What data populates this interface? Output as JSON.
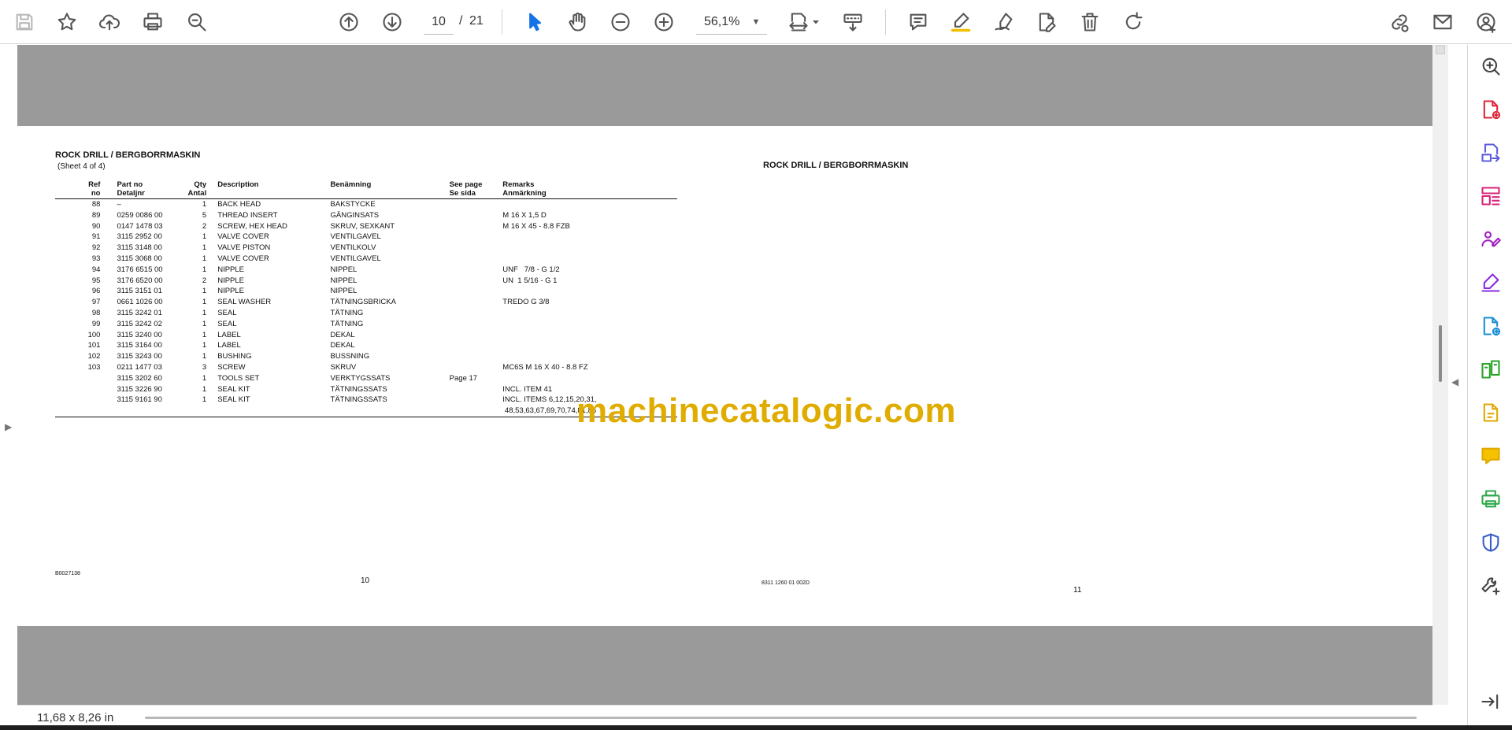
{
  "toolbar": {
    "page_current": "10",
    "page_separator": "/",
    "page_total": "21",
    "zoom": "56,1%"
  },
  "icons": {
    "save": "save-icon",
    "bookmark": "star-icon",
    "upload": "cloud-upload-icon",
    "print": "print-icon",
    "find": "search-icon",
    "prev_page": "arrow-up-circle-icon",
    "next_page": "arrow-down-circle-icon",
    "zoom_out": "zoom-out-icon",
    "zoom_in": "zoom-in-icon",
    "select": "cursor-icon",
    "hand": "hand-icon",
    "fit": "fit-page-icon",
    "scroll": "scroll-mode-icon",
    "comment": "comment-icon",
    "highlight": "highlight-icon",
    "sign": "sign-icon",
    "edit_pdf": "edit-pdf-icon",
    "delete": "trash-icon",
    "rotate": "rotate-icon",
    "share_link": "share-link-icon",
    "email": "mail-icon",
    "account": "account-icon"
  },
  "left_page": {
    "title": "ROCK DRILL / BERGBORRMASKIN",
    "subtitle": "(Sheet 4 of 4)",
    "headers": {
      "ref1": "Ref",
      "ref2": "no",
      "part1": "Part no",
      "part2": "Detaljnr",
      "qty1": "Qty",
      "qty2": "Antal",
      "desc": "Description",
      "ben": "Benämning",
      "see1": "See page",
      "see2": "Se sida",
      "rem1": "Remarks",
      "rem2": "Anmärkning"
    },
    "rows": [
      {
        "ref": "88",
        "part": "–",
        "qty": "1",
        "desc": "BACK HEAD",
        "ben": "BAKSTYCKE",
        "see": "",
        "rem": ""
      },
      {
        "ref": "89",
        "part": "0259 0086 00",
        "qty": "5",
        "desc": "THREAD INSERT",
        "ben": "GÄNGINSATS",
        "see": "",
        "rem": "M 16 X 1,5 D"
      },
      {
        "ref": "90",
        "part": "0147 1478 03",
        "qty": "2",
        "desc": "SCREW, HEX HEAD",
        "ben": "SKRUV, SEXKANT",
        "see": "",
        "rem": "M 16 X 45 - 8.8 FZB"
      },
      {
        "ref": "91",
        "part": "3115 2952 00",
        "qty": "1",
        "desc": "VALVE COVER",
        "ben": "VENTILGAVEL",
        "see": "",
        "rem": ""
      },
      {
        "ref": "92",
        "part": "3115 3148 00",
        "qty": "1",
        "desc": "VALVE PISTON",
        "ben": "VENTILKOLV",
        "see": "",
        "rem": ""
      },
      {
        "ref": "93",
        "part": "3115 3068 00",
        "qty": "1",
        "desc": "VALVE COVER",
        "ben": "VENTILGAVEL",
        "see": "",
        "rem": ""
      },
      {
        "ref": "94",
        "part": "3176 6515 00",
        "qty": "1",
        "desc": "NIPPLE",
        "ben": "NIPPEL",
        "see": "",
        "rem": "UNF   7/8 - G 1/2"
      },
      {
        "ref": "95",
        "part": "3176 6520 00",
        "qty": "2",
        "desc": "NIPPLE",
        "ben": "NIPPEL",
        "see": "",
        "rem": "UN  1 5/16 - G 1"
      },
      {
        "ref": "96",
        "part": "3115 3151 01",
        "qty": "1",
        "desc": "NIPPLE",
        "ben": "NIPPEL",
        "see": "",
        "rem": ""
      },
      {
        "ref": "97",
        "part": "0661 1026 00",
        "qty": "1",
        "desc": "SEAL WASHER",
        "ben": "TÄTNINGSBRICKA",
        "see": "",
        "rem": "TREDO G 3/8"
      },
      {
        "ref": "98",
        "part": "3115 3242 01",
        "qty": "1",
        "desc": "SEAL",
        "ben": "TÄTNING",
        "see": "",
        "rem": ""
      },
      {
        "ref": "99",
        "part": "3115 3242 02",
        "qty": "1",
        "desc": "SEAL",
        "ben": "TÄTNING",
        "see": "",
        "rem": ""
      },
      {
        "ref": "100",
        "part": "3115 3240 00",
        "qty": "1",
        "desc": "LABEL",
        "ben": "DEKAL",
        "see": "",
        "rem": ""
      },
      {
        "ref": "101",
        "part": "3115 3164 00",
        "qty": "1",
        "desc": "LABEL",
        "ben": "DEKAL",
        "see": "",
        "rem": ""
      },
      {
        "ref": "102",
        "part": "3115 3243 00",
        "qty": "1",
        "desc": "BUSHING",
        "ben": "BUSSNING",
        "see": "",
        "rem": ""
      },
      {
        "ref": "103",
        "part": "0211 1477 03",
        "qty": "3",
        "desc": "SCREW",
        "ben": "SKRUV",
        "see": "",
        "rem": "MC6S M 16 X 40 - 8.8 FZ"
      },
      {
        "ref": "",
        "part": "3115 3202 60",
        "qty": "1",
        "desc": "TOOLS SET",
        "ben": "VERKTYGSSATS",
        "see": "Page 17",
        "rem": ""
      },
      {
        "ref": "",
        "part": "3115 3226 90",
        "qty": "1",
        "desc": "SEAL KIT",
        "ben": "TÄTNINGSSATS",
        "see": "",
        "rem": "INCL. ITEM 41"
      },
      {
        "ref": "",
        "part": "3115 9161 90",
        "qty": "1",
        "desc": "SEAL KIT",
        "ben": "TÄTNINGSSATS",
        "see": "",
        "rem": "INCL. ITEMS 6,12,15,20,31,\n 48,53,63,67,69,70,74,81,86"
      }
    ],
    "doc_code": "B0027138",
    "page_number": "10"
  },
  "right_page": {
    "title": "ROCK DRILL / BERGBORRMASKIN",
    "doc_code": "8311 1260 01  002D",
    "page_number": "11"
  },
  "watermark": "machinecatalogic.com",
  "status": {
    "page_size": "11,68 x 8,26 in"
  },
  "colors": {
    "viewport_bg": "#9a9a9a",
    "accent_blue": "#1473e6",
    "watermark": "#e0ac00"
  }
}
